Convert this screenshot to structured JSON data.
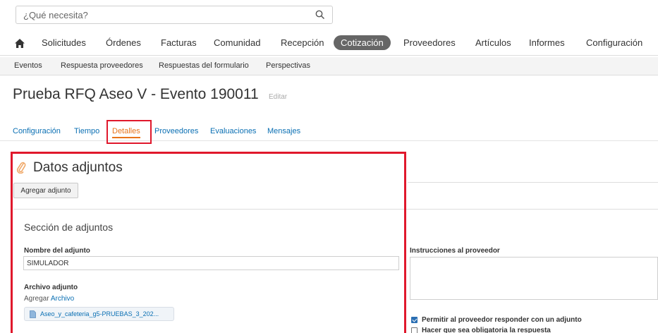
{
  "search": {
    "placeholder": "¿Qué necesita?"
  },
  "colors": {
    "accent": "#e8731a",
    "link": "#0a6fb3",
    "highlight": "#e0182c",
    "nav_active": "#666666"
  },
  "main_nav": [
    {
      "label": "Solicitudes"
    },
    {
      "label": "Órdenes"
    },
    {
      "label": "Facturas"
    },
    {
      "label": "Comunidad"
    },
    {
      "label": "Recepción"
    },
    {
      "label": "Cotización",
      "active": true
    },
    {
      "label": "Proveedores"
    },
    {
      "label": "Artículos"
    },
    {
      "label": "Informes"
    },
    {
      "label": "Configuración"
    }
  ],
  "sub_nav": [
    {
      "label": "Eventos"
    },
    {
      "label": "Respuesta proveedores"
    },
    {
      "label": "Respuestas del formulario"
    },
    {
      "label": "Perspectivas"
    }
  ],
  "page": {
    "title": "Prueba RFQ Aseo V - Evento 190011",
    "edit_label": "Editar"
  },
  "tabs": [
    {
      "label": "Configuración"
    },
    {
      "label": "Tiempo"
    },
    {
      "label": "Detalles",
      "active": true
    },
    {
      "label": "Proveedores"
    },
    {
      "label": "Evaluaciones"
    },
    {
      "label": "Mensajes"
    }
  ],
  "attachments": {
    "section_title": "Datos adjuntos",
    "add_button": "Agregar adjunto",
    "subsection_title": "Sección de adjuntos",
    "name_label": "Nombre del adjunto",
    "name_value": "SIMULADOR",
    "file_label": "Archivo adjunto",
    "add_prefix": "Agregar",
    "add_link": "Archivo",
    "file_name": "Aseo_y_cafeteria_g5-PRUEBAS_3_202...",
    "instructions_label": "Instrucciones al proveedor",
    "instructions_value": "",
    "options": [
      {
        "label": "Permitir al proveedor responder con un adjunto",
        "checked": true
      },
      {
        "label": "Hacer que sea obligatoria la respuesta",
        "checked": false
      }
    ]
  },
  "icons": {
    "home": "home-icon",
    "search": "search-icon",
    "attachment": "paperclip-icon",
    "file": "document-icon"
  }
}
